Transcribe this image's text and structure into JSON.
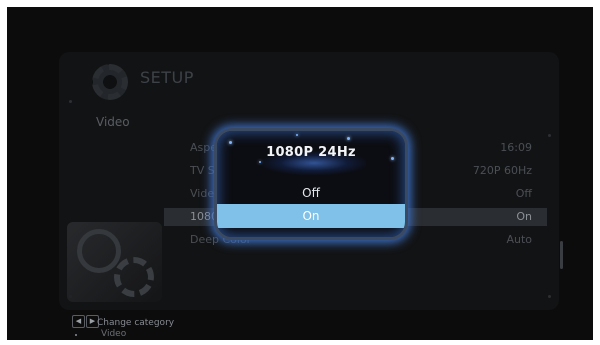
{
  "setup": {
    "title": "SETUP",
    "category": "Video"
  },
  "settings": [
    {
      "label": "Aspect Ratio",
      "value": "16:09"
    },
    {
      "label": "TV System",
      "value": "720P 60Hz"
    },
    {
      "label": "Video Zoom",
      "value": "Off"
    },
    {
      "label": "1080P 24Hz",
      "value": "On"
    },
    {
      "label": "Deep Color",
      "value": "Auto"
    }
  ],
  "dialog": {
    "title": "1080P 24Hz",
    "options": [
      "Off",
      "On"
    ],
    "selected": "On"
  },
  "footer": {
    "hint": "Change category",
    "current": "Video"
  },
  "colors": {
    "highlight": "#7fc1e8",
    "glow": "#3e6fc2"
  }
}
